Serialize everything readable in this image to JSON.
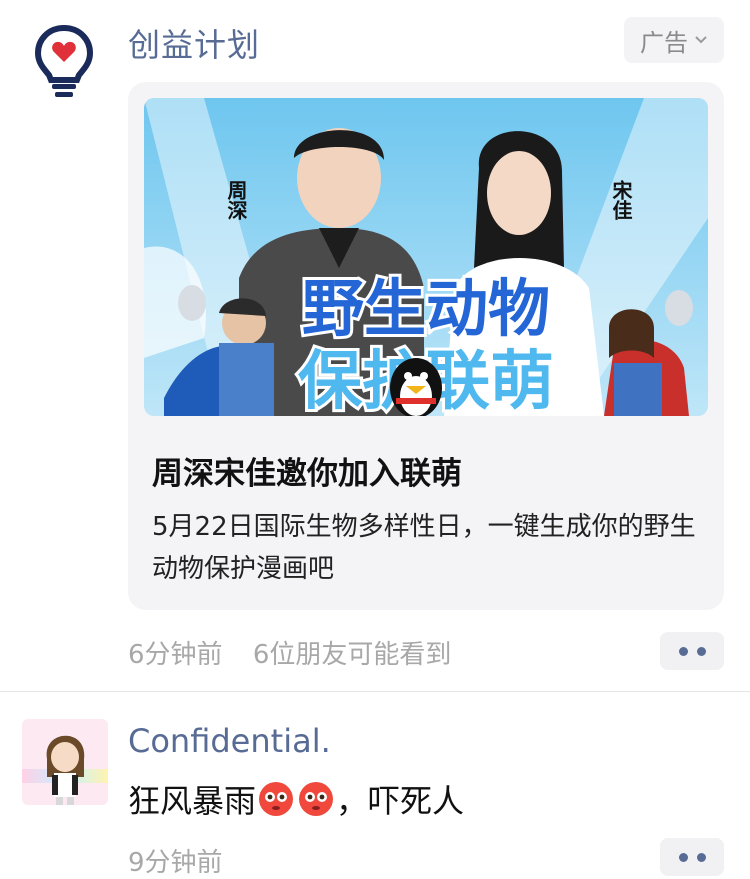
{
  "ad_post": {
    "author": "创益计划",
    "ad_label": "广告",
    "image": {
      "left_name": "周深",
      "right_name": "宋佳",
      "banner_line1": "野生动物",
      "banner_line2": "保护联萌"
    },
    "title": "周深宋佳邀你加入联萌",
    "description": "5月22日国际生物多样性日，一键生成你的野生动物保护漫画吧",
    "time": "6分钟前",
    "visibility": "6位朋友可能看到"
  },
  "user_post": {
    "author": "Confidential.",
    "text_before": "狂风暴雨",
    "text_after": "，吓死人",
    "time": "9分钟前"
  },
  "colors": {
    "link_blue": "#576b95",
    "logo_red": "#e0303a",
    "logo_navy": "#1a2a5a",
    "card_bg": "#f4f4f6"
  }
}
